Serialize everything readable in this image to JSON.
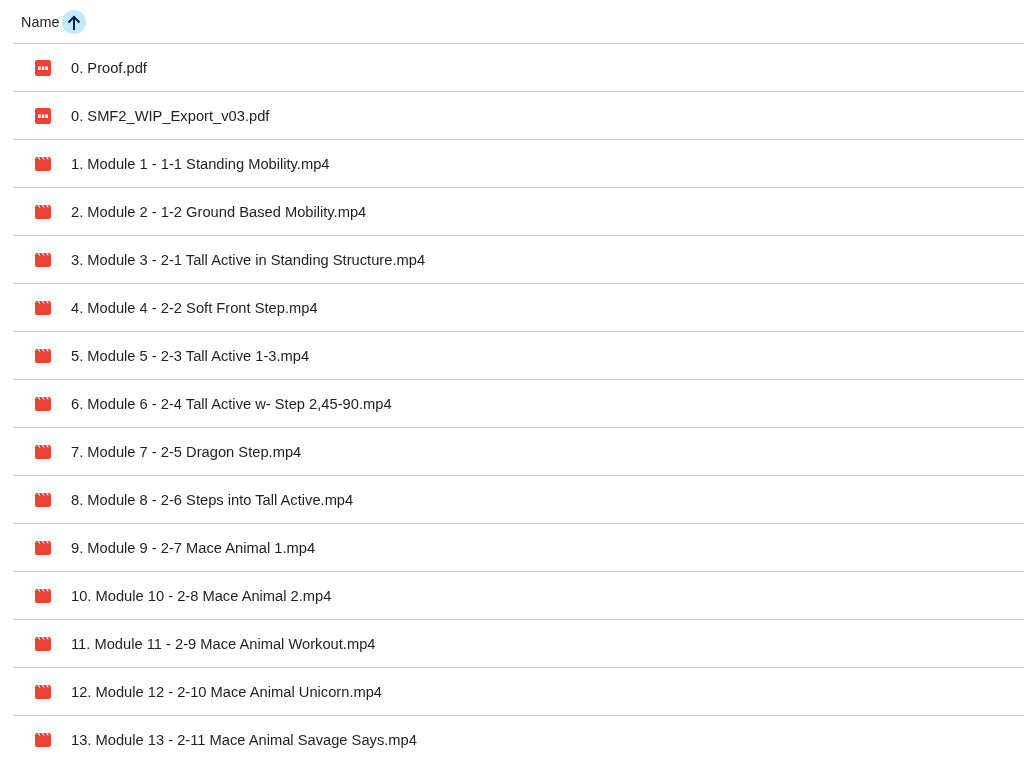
{
  "header": {
    "column": "Name",
    "sort_ascending": true
  },
  "files": [
    {
      "kind": "pdf",
      "name": "0. Proof.pdf"
    },
    {
      "kind": "pdf",
      "name": "0. SMF2_WIP_Export_v03.pdf"
    },
    {
      "kind": "video",
      "name": "1. Module 1 - 1-1 Standing Mobility.mp4"
    },
    {
      "kind": "video",
      "name": "2. Module 2 - 1-2 Ground Based Mobility.mp4"
    },
    {
      "kind": "video",
      "name": "3. Module 3 - 2-1 Tall Active in Standing Structure.mp4"
    },
    {
      "kind": "video",
      "name": "4. Module 4 - 2-2 Soft Front Step.mp4"
    },
    {
      "kind": "video",
      "name": "5. Module 5 - 2-3 Tall Active 1-3.mp4"
    },
    {
      "kind": "video",
      "name": "6. Module 6 - 2-4 Tall Active w- Step 2,45-90.mp4"
    },
    {
      "kind": "video",
      "name": "7. Module 7 - 2-5 Dragon Step.mp4"
    },
    {
      "kind": "video",
      "name": "8. Module 8 - 2-6 Steps into Tall Active.mp4"
    },
    {
      "kind": "video",
      "name": "9. Module 9 - 2-7 Mace Animal 1.mp4"
    },
    {
      "kind": "video",
      "name": "10. Module 10 - 2-8 Mace Animal 2.mp4"
    },
    {
      "kind": "video",
      "name": "11. Module 11 - 2-9 Mace Animal Workout.mp4"
    },
    {
      "kind": "video",
      "name": "12. Module 12 - 2-10 Mace Animal Unicorn.mp4"
    },
    {
      "kind": "video",
      "name": "13. Module 13 - 2-11 Mace Animal Savage Says.mp4"
    }
  ]
}
